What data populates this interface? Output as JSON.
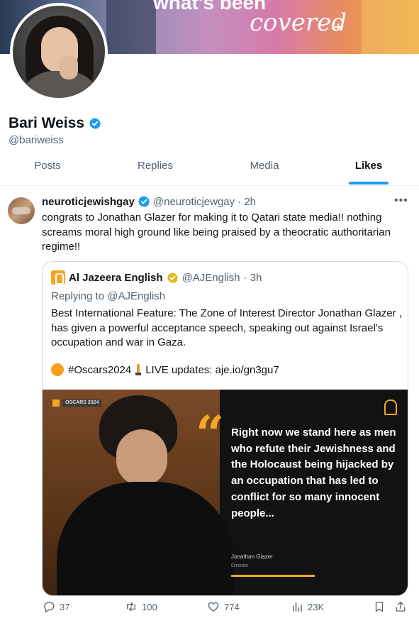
{
  "banner": {
    "line1": "what's been",
    "line2": "covered",
    "plus": "+"
  },
  "profile": {
    "name": "Bari Weiss",
    "handle": "@bariweiss",
    "verified_color": "#1d9bf0"
  },
  "tabs": [
    {
      "label": "Posts"
    },
    {
      "label": "Replies"
    },
    {
      "label": "Media"
    },
    {
      "label": "Likes",
      "active": true
    }
  ],
  "tweet": {
    "author_name": "neuroticjewishgay",
    "author_handle": "@neuroticjewgay",
    "time": "· 2h",
    "more_icon": "more-horizontal-icon",
    "text": "congrats to Jonathan Glazer for making it to Qatari state media!! nothing screams moral high ground like being praised by a theocratic authoritarian regime!!",
    "quote": {
      "author_name": "Al Jazeera English",
      "author_handle": "@AJEnglish",
      "time": "· 3h",
      "verified_color": "#e2b719",
      "replying_to": "Replying to @AJEnglish",
      "text": "Best International Feature: The Zone of Interest  Director Jonathan Glazer , has given a powerful acceptance speech, speaking out against Israel’s occupation and war in Gaza.",
      "hashtag": "#Oscars2024",
      "live_updates": "LIVE updates: aje.io/gn3gu7",
      "media": {
        "badge": "OSCARS 2024",
        "quote_mark": "“",
        "quote_text": "Right now we stand here as men who refute their Jewishness and the Holocaust being hijacked by an occupation that has led to conflict for so many innocent people...",
        "author": "Jonathan Glazer",
        "role": "Director",
        "accent_color": "#f5a623"
      }
    },
    "actions": {
      "replies": "37",
      "reposts": "100",
      "likes": "774",
      "views": "23K"
    }
  }
}
